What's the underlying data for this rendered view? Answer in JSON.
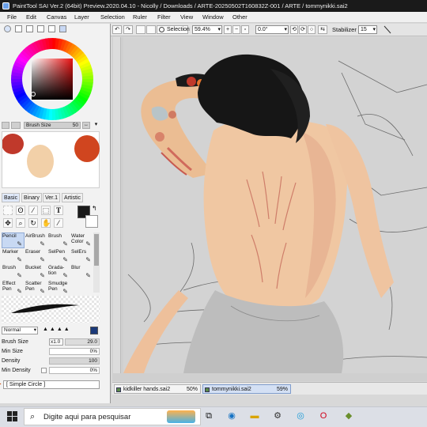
{
  "window": {
    "title": "PaintTool SAI Ver.2 (64bit) Preview.2020.04.10 - Nicolly / Downloads / ARTE-20250502T160832Z-001 / ARTE / tommynikki.sai2"
  },
  "menu": [
    "File",
    "Edit",
    "Canvas",
    "Layer",
    "Selection",
    "Ruler",
    "Filter",
    "View",
    "Window",
    "Other"
  ],
  "toolbar": {
    "selection_label": "Selection",
    "zoom": "59.4%",
    "rotation": "0.0°",
    "stabilizer_label": "Stabilizer",
    "stabilizer_value": "15"
  },
  "color_panel": {
    "brush_size_label": "Brush Size",
    "brush_size_value": "50"
  },
  "swatch_colors": [
    "#c0392b",
    "#d0451f",
    "#f2d0a8"
  ],
  "toolset_tabs": [
    "Basic",
    "Binary",
    "Ver.1",
    "Artistic"
  ],
  "brushes": [
    {
      "label": "Pencil",
      "icon": "pencil-icon"
    },
    {
      "label": "AirBrush",
      "icon": "airbrush-icon"
    },
    {
      "label": "Brush",
      "icon": "brush-icon"
    },
    {
      "label": "Water Color",
      "icon": "watercolor-icon"
    },
    {
      "label": "Marker",
      "icon": "marker-icon"
    },
    {
      "label": "Eraser",
      "icon": "eraser-icon"
    },
    {
      "label": "SelPen",
      "icon": "selpen-icon"
    },
    {
      "label": "SelErs",
      "icon": "selers-icon"
    },
    {
      "label": "Brush",
      "icon": "brush-icon"
    },
    {
      "label": "Bucket",
      "icon": "bucket-icon"
    },
    {
      "label": "Grada- tion",
      "icon": "gradation-icon"
    },
    {
      "label": "Blur",
      "icon": "blur-icon"
    },
    {
      "label": "Effect Pen",
      "icon": "effect-pen-icon"
    },
    {
      "label": "Scatter Pen",
      "icon": "scatter-pen-icon"
    },
    {
      "label": "Smudge Pen",
      "icon": "smudge-pen-icon"
    }
  ],
  "brush_props": {
    "blend_mode": "Normal",
    "brush_size_label": "Brush Size",
    "brush_size_mult": "x1.0",
    "brush_size_value": "29.0",
    "min_size_label": "Min Size",
    "min_size_value": "0%",
    "density_label": "Density",
    "density_value": "100",
    "min_density_label": "Min Density",
    "min_density_value": "0%",
    "shape": "[ Simple Circle ]"
  },
  "doc_tabs": [
    {
      "name": "kidkiller hands.sai2",
      "zoom": "50%"
    },
    {
      "name": "tommynikki.sai2",
      "zoom": "59%"
    }
  ],
  "taskbar": {
    "search_placeholder": "Digite aqui para pesquisar"
  }
}
